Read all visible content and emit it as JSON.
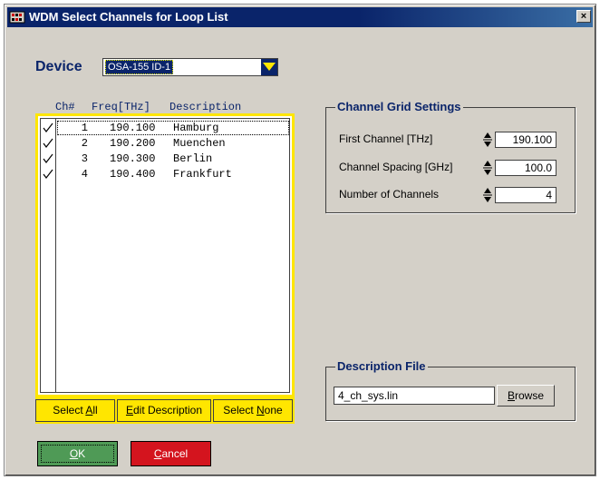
{
  "window": {
    "title": "WDM Select Channels for Loop List",
    "close_symbol": "×"
  },
  "device": {
    "label": "Device",
    "selected": "OSA-155 ID-1"
  },
  "channel_list": {
    "headers": {
      "ch": "Ch#",
      "freq": "Freq[THz]",
      "desc": "Description"
    },
    "rows": [
      {
        "checked": true,
        "ch": "1",
        "freq": "190.100",
        "desc": "Hamburg"
      },
      {
        "checked": true,
        "ch": "2",
        "freq": "190.200",
        "desc": "Muenchen"
      },
      {
        "checked": true,
        "ch": "3",
        "freq": "190.300",
        "desc": "Berlin"
      },
      {
        "checked": true,
        "ch": "4",
        "freq": "190.400",
        "desc": "Frankfurt"
      }
    ],
    "buttons": {
      "select_all_prefix": "Select ",
      "select_all_key": "A",
      "select_all_suffix": "ll",
      "edit_prefix": "",
      "edit_key": "E",
      "edit_suffix": "dit Description",
      "select_none_prefix": "Select ",
      "select_none_key": "N",
      "select_none_suffix": "one"
    }
  },
  "grid_settings": {
    "legend": "Channel Grid Settings",
    "first_channel": {
      "label": "First Channel [THz]",
      "value": "190.100"
    },
    "channel_spacing": {
      "label": "Channel Spacing [GHz]",
      "value": "100.0"
    },
    "num_channels": {
      "label": "Number of Channels",
      "value": "4"
    }
  },
  "description_file": {
    "legend": "Description File",
    "value": "4_ch_sys.lin",
    "browse_key": "B",
    "browse_rest": "rowse"
  },
  "actions": {
    "ok_key": "O",
    "ok_rest": "K",
    "cancel_key": "C",
    "cancel_rest": "ancel"
  },
  "colors": {
    "title_bar": "#0a246a",
    "list_border": "#ffe600",
    "ok": "#4f9a56",
    "cancel": "#d4141e",
    "label": "#0a246a"
  }
}
